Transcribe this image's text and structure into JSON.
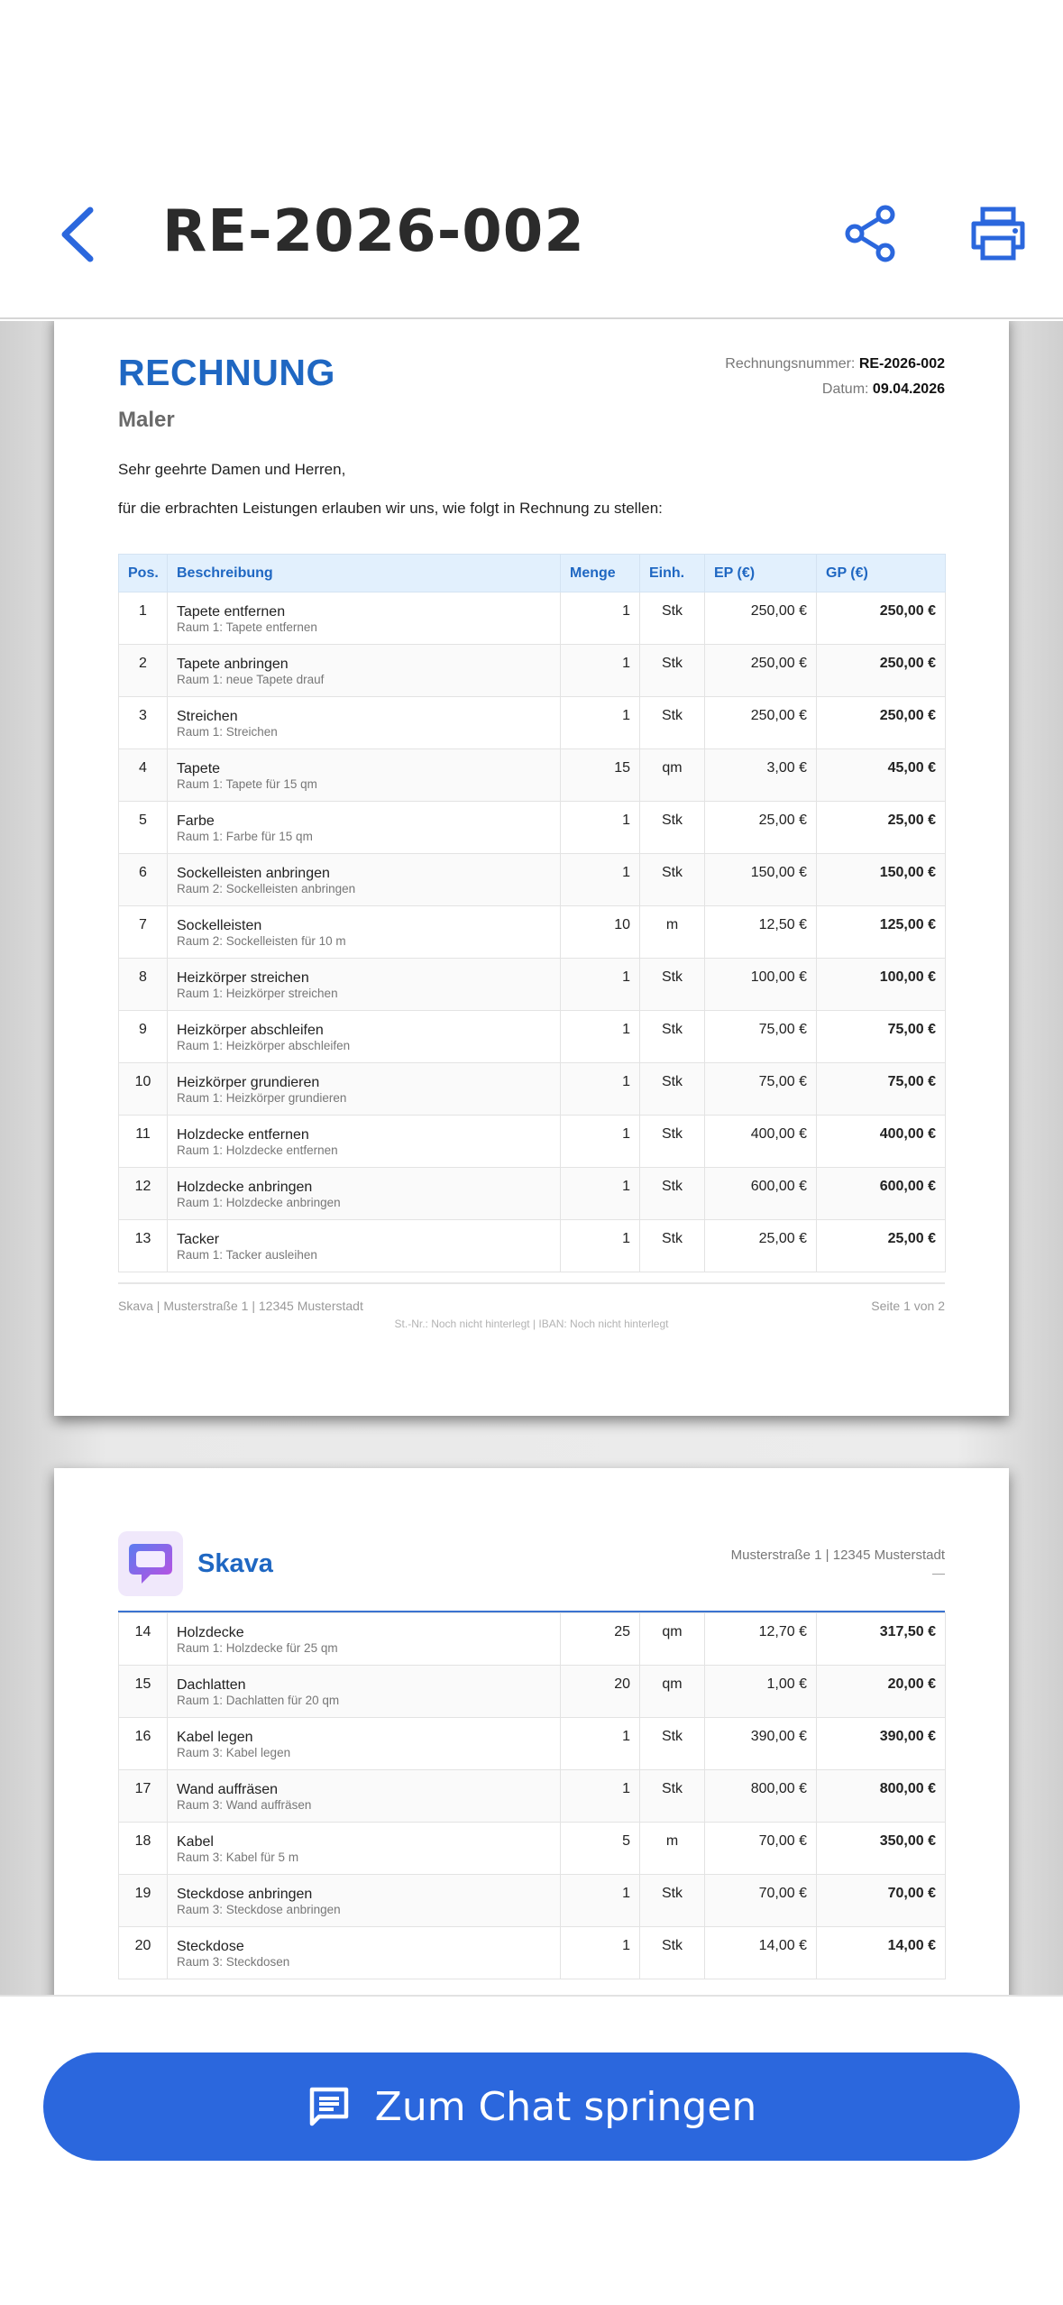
{
  "header": {
    "title": "RE-2026-002",
    "back_icon": "chevron-left-icon",
    "share_icon": "share-icon",
    "print_icon": "printer-icon",
    "accent_color": "#2b67dd"
  },
  "invoice": {
    "heading": "RECHNUNG",
    "trade": "Maler",
    "number_label": "Rechnungsnummer:",
    "number": "RE-2026-002",
    "date_label": "Datum:",
    "date": "09.04.2026",
    "greeting": "Sehr geehrte Damen und Herren,",
    "intro": "für die erbrachten Leistungen erlauben wir uns, wie folgt in Rechnung zu stellen:",
    "columns": [
      "Pos.",
      "Beschreibung",
      "Menge",
      "Einh.",
      "EP (€)",
      "GP (€)"
    ],
    "page1_rows": [
      {
        "pos": "1",
        "title": "Tapete entfernen",
        "sub": "Raum 1: Tapete entfernen",
        "qty": "1",
        "unit": "Stk",
        "ep": "250,00 €",
        "gp": "250,00 €"
      },
      {
        "pos": "2",
        "title": "Tapete anbringen",
        "sub": "Raum 1: neue Tapete drauf",
        "qty": "1",
        "unit": "Stk",
        "ep": "250,00 €",
        "gp": "250,00 €"
      },
      {
        "pos": "3",
        "title": "Streichen",
        "sub": "Raum 1: Streichen",
        "qty": "1",
        "unit": "Stk",
        "ep": "250,00 €",
        "gp": "250,00 €"
      },
      {
        "pos": "4",
        "title": "Tapete",
        "sub": "Raum 1: Tapete für 15 qm",
        "qty": "15",
        "unit": "qm",
        "ep": "3,00 €",
        "gp": "45,00 €"
      },
      {
        "pos": "5",
        "title": "Farbe",
        "sub": "Raum 1: Farbe für 15 qm",
        "qty": "1",
        "unit": "Stk",
        "ep": "25,00 €",
        "gp": "25,00 €"
      },
      {
        "pos": "6",
        "title": "Sockelleisten anbringen",
        "sub": "Raum 2: Sockelleisten anbringen",
        "qty": "1",
        "unit": "Stk",
        "ep": "150,00 €",
        "gp": "150,00 €"
      },
      {
        "pos": "7",
        "title": "Sockelleisten",
        "sub": "Raum 2: Sockelleisten für 10 m",
        "qty": "10",
        "unit": "m",
        "ep": "12,50 €",
        "gp": "125,00 €"
      },
      {
        "pos": "8",
        "title": "Heizkörper streichen",
        "sub": "Raum 1: Heizkörper streichen",
        "qty": "1",
        "unit": "Stk",
        "ep": "100,00 €",
        "gp": "100,00 €"
      },
      {
        "pos": "9",
        "title": "Heizkörper abschleifen",
        "sub": "Raum 1: Heizkörper abschleifen",
        "qty": "1",
        "unit": "Stk",
        "ep": "75,00 €",
        "gp": "75,00 €"
      },
      {
        "pos": "10",
        "title": "Heizkörper grundieren",
        "sub": "Raum 1: Heizkörper grundieren",
        "qty": "1",
        "unit": "Stk",
        "ep": "75,00 €",
        "gp": "75,00 €"
      },
      {
        "pos": "11",
        "title": "Holzdecke entfernen",
        "sub": "Raum 1: Holzdecke entfernen",
        "qty": "1",
        "unit": "Stk",
        "ep": "400,00 €",
        "gp": "400,00 €"
      },
      {
        "pos": "12",
        "title": "Holzdecke anbringen",
        "sub": "Raum 1: Holzdecke anbringen",
        "qty": "1",
        "unit": "Stk",
        "ep": "600,00 €",
        "gp": "600,00 €"
      },
      {
        "pos": "13",
        "title": "Tacker",
        "sub": "Raum 1: Tacker ausleihen",
        "qty": "1",
        "unit": "Stk",
        "ep": "25,00 €",
        "gp": "25,00 €"
      }
    ],
    "footer_address": "Skava | Musterstraße 1 | 12345 Musterstadt",
    "footer_page": "Seite 1 von 2",
    "footer_tax": "St.-Nr.: Noch nicht hinterlegt | IBAN: Noch nicht hinterlegt",
    "page2": {
      "brand": "Skava",
      "logo_icon": "chat-bubble-logo-icon",
      "address": "Musterstraße 1 | 12345 Musterstadt",
      "dash": "—",
      "rows": [
        {
          "pos": "14",
          "title": "Holzdecke",
          "sub": "Raum 1: Holzdecke für 25 qm",
          "qty": "25",
          "unit": "qm",
          "ep": "12,70 €",
          "gp": "317,50 €"
        },
        {
          "pos": "15",
          "title": "Dachlatten",
          "sub": "Raum 1: Dachlatten für 20 qm",
          "qty": "20",
          "unit": "qm",
          "ep": "1,00 €",
          "gp": "20,00 €"
        },
        {
          "pos": "16",
          "title": "Kabel legen",
          "sub": "Raum 3: Kabel legen",
          "qty": "1",
          "unit": "Stk",
          "ep": "390,00 €",
          "gp": "390,00 €"
        },
        {
          "pos": "17",
          "title": "Wand auffräsen",
          "sub": "Raum 3: Wand auffräsen",
          "qty": "1",
          "unit": "Stk",
          "ep": "800,00 €",
          "gp": "800,00 €"
        },
        {
          "pos": "18",
          "title": "Kabel",
          "sub": "Raum 3: Kabel für 5 m",
          "qty": "5",
          "unit": "m",
          "ep": "70,00 €",
          "gp": "350,00 €"
        },
        {
          "pos": "19",
          "title": "Steckdose anbringen",
          "sub": "Raum 3: Steckdose anbringen",
          "qty": "1",
          "unit": "Stk",
          "ep": "70,00 €",
          "gp": "70,00 €"
        },
        {
          "pos": "20",
          "title": "Steckdose",
          "sub": "Raum 3: Steckdosen",
          "qty": "1",
          "unit": "Stk",
          "ep": "14,00 €",
          "gp": "14,00 €"
        }
      ]
    }
  },
  "bottom": {
    "chat_label": "Zum Chat springen",
    "chat_icon": "chat-message-icon"
  }
}
